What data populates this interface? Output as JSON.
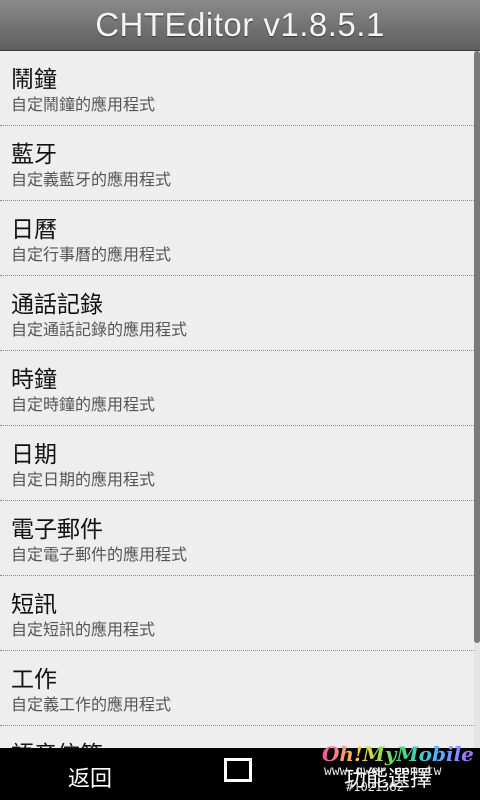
{
  "header": {
    "title": "CHTEditor v1.8.5.1"
  },
  "items": [
    {
      "title": "鬧鐘",
      "subtitle": "自定鬧鐘的應用程式"
    },
    {
      "title": "藍牙",
      "subtitle": "自定義藍牙的應用程式"
    },
    {
      "title": "日曆",
      "subtitle": "自定行事曆的應用程式"
    },
    {
      "title": "通話記錄",
      "subtitle": "自定通話記錄的應用程式"
    },
    {
      "title": "時鐘",
      "subtitle": "自定時鐘的應用程式"
    },
    {
      "title": "日期",
      "subtitle": "自定日期的應用程式"
    },
    {
      "title": "電子郵件",
      "subtitle": "自定電子郵件的應用程式"
    },
    {
      "title": "短訊",
      "subtitle": "自定短訊的應用程式"
    },
    {
      "title": "工作",
      "subtitle": "自定義工作的應用程式"
    },
    {
      "title": "語音信箱",
      "subtitle": ""
    }
  ],
  "bottom_bar": {
    "back_label": "返回",
    "menu_label": "功能選擇"
  },
  "watermark": {
    "logo": "Oh!MyMobile",
    "site": "www.qwer.com.tw",
    "id": "#1021382"
  }
}
